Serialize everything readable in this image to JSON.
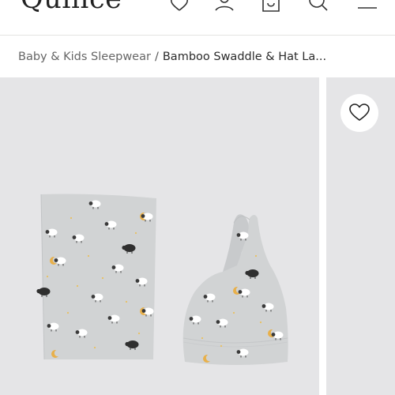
{
  "header": {
    "logo_text": "Quince",
    "icons": [
      "heart-icon",
      "account-icon",
      "bag-icon",
      "search-icon",
      "menu-icon"
    ]
  },
  "breadcrumb": {
    "parent": "Baby & Kids Sleepwear",
    "separator": "/",
    "current": "Bamboo Swaddle & Hat La..."
  },
  "gallery": {
    "wishlist_icon": "heart-icon",
    "product_items": [
      "swaddle-blanket",
      "knotted-baby-hat"
    ]
  },
  "colors": {
    "photo_background": "#e5e5e7",
    "fabric": "#d1d3d4",
    "text": "#2b2b2b"
  }
}
